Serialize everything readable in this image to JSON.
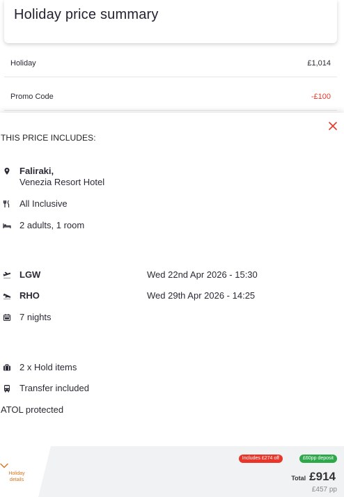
{
  "header": {
    "title": "Holiday price summary"
  },
  "price_rows": [
    {
      "label": "Holiday",
      "value": "£1,014"
    },
    {
      "label": "Promo Code",
      "value": "-£100"
    }
  ],
  "includes": {
    "heading": "THIS PRICE INCLUDES:",
    "destination": "Faliraki,",
    "hotel": "Venezia Resort Hotel",
    "board": "All Inclusive",
    "occupancy": "2 adults, 1 room",
    "outbound": {
      "airport": "LGW",
      "datetime": "Wed 22nd Apr 2026 - 15:30"
    },
    "return": {
      "airport": "RHO",
      "datetime": "Wed 29th Apr 2026 - 14:25"
    },
    "duration": "7 nights",
    "luggage": "2 x Hold items",
    "transfer": "Transfer included",
    "atol": "ATOL protected"
  },
  "footer": {
    "tab_line1": "Holiday",
    "tab_line2": "details",
    "discount_badge": "Includes £274 off",
    "deposit_badge": "£60pp deposit",
    "total_label": "Total",
    "total_value": "£914",
    "per_person": "£457 pp"
  },
  "colors": {
    "accent": "#e8372a",
    "green": "#2ea84a",
    "orange": "#d9731c"
  }
}
